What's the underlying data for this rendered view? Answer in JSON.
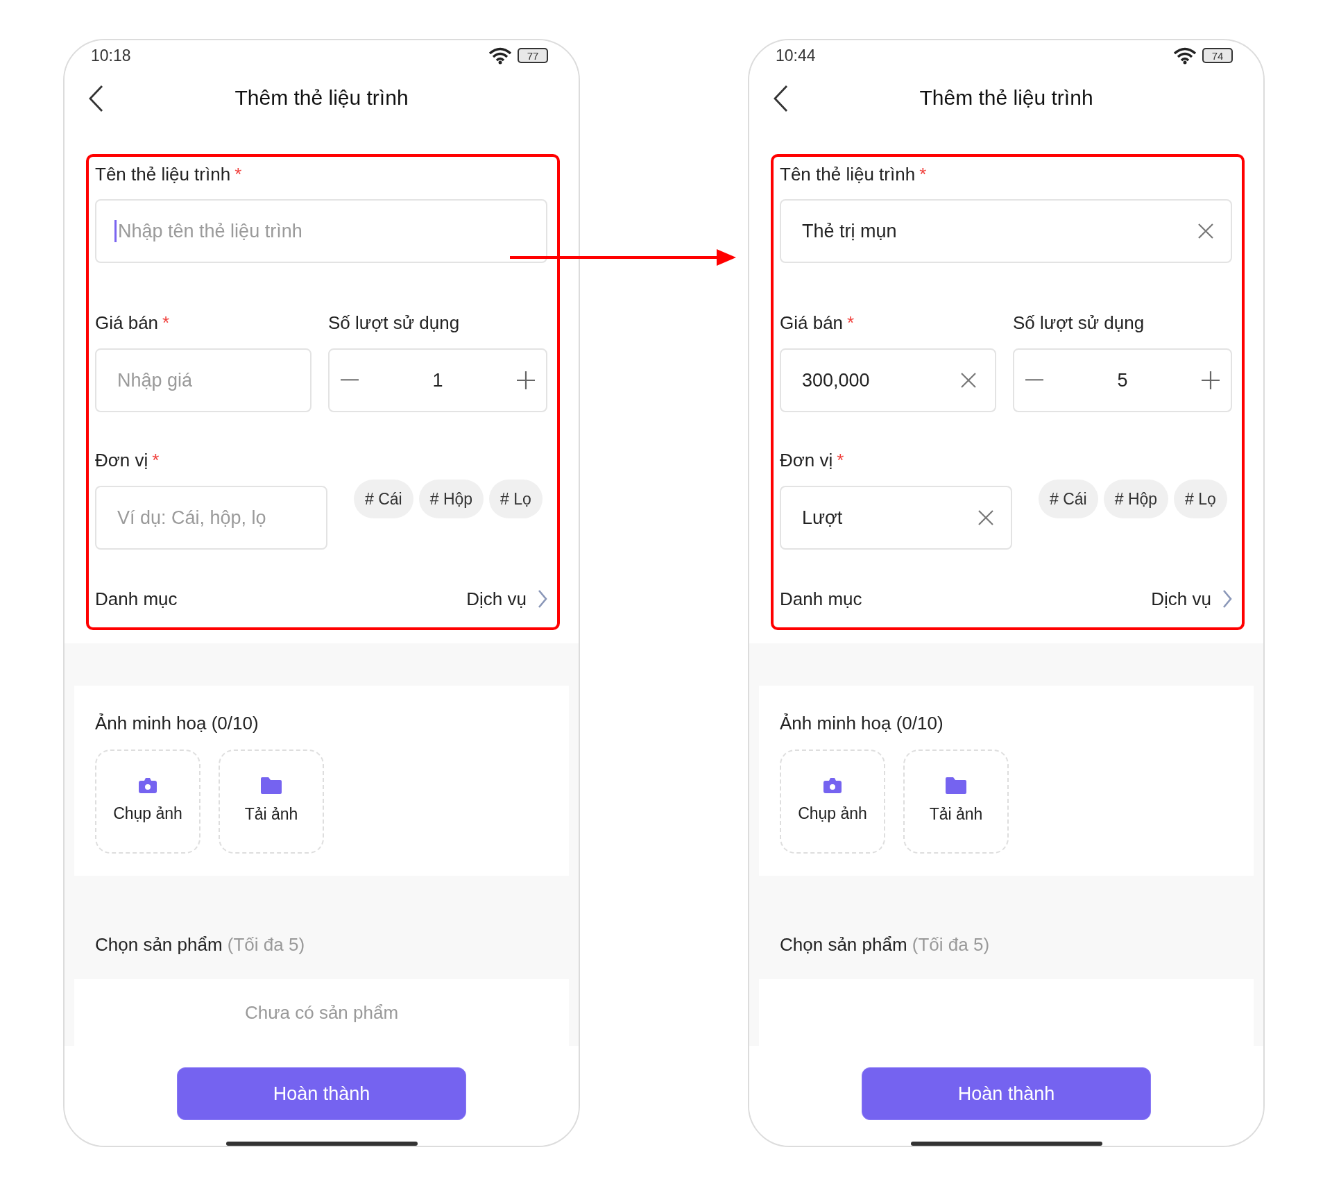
{
  "phones": [
    {
      "status_bar": {
        "time": "10:18",
        "battery": "77"
      },
      "title": "Thêm thẻ liệu trình",
      "form": {
        "name": {
          "label": "Tên thẻ liệu trình",
          "required_mark": "*",
          "placeholder": "Nhập tên thẻ liệu trình",
          "focused": true
        },
        "price": {
          "label": "Giá bán",
          "required_mark": "*",
          "placeholder": "Nhập giá"
        },
        "uses": {
          "label": "Số lượt sử dụng",
          "value": "1"
        },
        "unit": {
          "label": "Đơn vị",
          "required_mark": "*",
          "placeholder": "Ví dụ: Cái, hộp, lọ",
          "chips": [
            "# Cái",
            "# Hộp",
            "# Lọ"
          ]
        },
        "category": {
          "label": "Danh mục",
          "value": "Dịch vụ"
        }
      },
      "images": {
        "label": "Ảnh minh hoạ (0/10)",
        "buttons": [
          {
            "kind": "camera",
            "label": "Chụp ảnh"
          },
          {
            "kind": "folder",
            "label": "Tải ảnh"
          }
        ]
      },
      "products": {
        "label": "Chọn sản phẩm",
        "hint": "(Tối đa 5)",
        "empty_text": "Chưa có sản phẩm"
      },
      "submit": "Hoàn thành"
    },
    {
      "status_bar": {
        "time": "10:44",
        "battery": "74"
      },
      "title": "Thêm thẻ liệu trình",
      "form": {
        "name": {
          "label": "Tên thẻ liệu trình",
          "required_mark": "*",
          "value": "Thẻ trị mụn",
          "focused": false
        },
        "price": {
          "label": "Giá bán",
          "required_mark": "*",
          "value": "300,000"
        },
        "uses": {
          "label": "Số lượt sử dụng",
          "value": "5"
        },
        "unit": {
          "label": "Đơn vị",
          "required_mark": "*",
          "value": "Lượt",
          "chips": [
            "# Cái",
            "# Hộp",
            "# Lọ"
          ]
        },
        "category": {
          "label": "Danh mục",
          "value": "Dịch vụ"
        }
      },
      "images": {
        "label": "Ảnh minh hoạ (0/10)",
        "buttons": [
          {
            "kind": "camera",
            "label": "Chụp ảnh"
          },
          {
            "kind": "folder",
            "label": "Tải ảnh"
          }
        ]
      },
      "products": {
        "label": "Chọn sản phẩm",
        "hint": "(Tối đa 5)"
      },
      "submit": "Hoàn thành"
    }
  ]
}
